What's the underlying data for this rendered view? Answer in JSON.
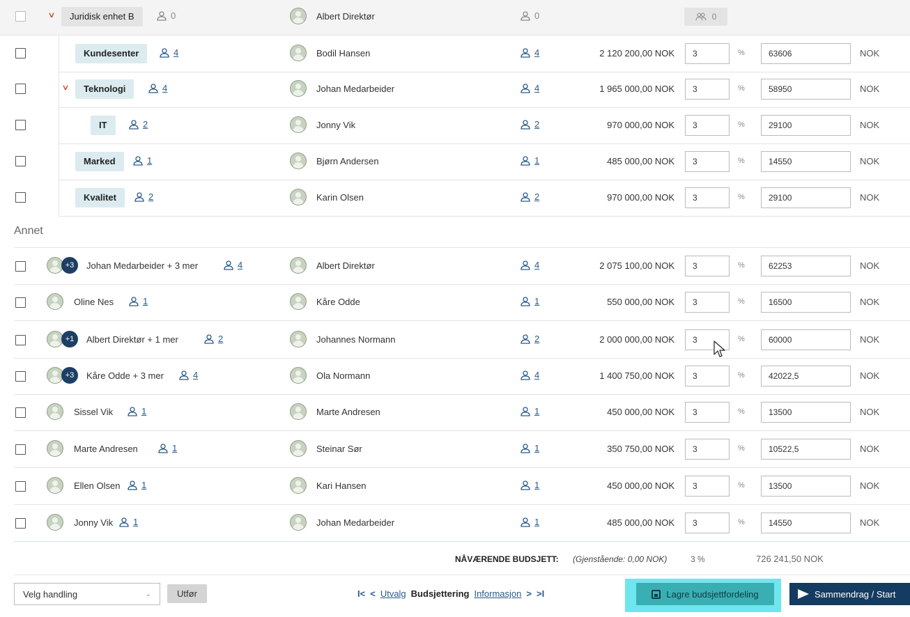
{
  "org_rows": [
    {
      "unit": "Juridisk enhet B",
      "unit_count": "0",
      "leader": "Albert Direktør",
      "leader_count": "0",
      "team_count": "0"
    },
    {
      "unit": "Kundesenter",
      "unit_count": "4",
      "leader": "Bodil Hansen",
      "leader_count": "4",
      "amount": "2 120 200,00 NOK",
      "pct": "3",
      "value": "63606",
      "currency": "NOK"
    },
    {
      "unit": "Teknologi",
      "unit_count": "4",
      "leader": "Johan Medarbeider",
      "leader_count": "4",
      "amount": "1 965 000,00 NOK",
      "pct": "3",
      "value": "58950",
      "currency": "NOK"
    },
    {
      "unit": "IT",
      "unit_count": "2",
      "leader": "Jonny Vik",
      "leader_count": "2",
      "amount": "970 000,00 NOK",
      "pct": "3",
      "value": "29100",
      "currency": "NOK"
    },
    {
      "unit": "Marked",
      "unit_count": "1",
      "leader": "Bjørn Andersen",
      "leader_count": "1",
      "amount": "485 000,00 NOK",
      "pct": "3",
      "value": "14550",
      "currency": "NOK"
    },
    {
      "unit": "Kvalitet",
      "unit_count": "2",
      "leader": "Karin Olsen",
      "leader_count": "2",
      "amount": "970 000,00 NOK",
      "pct": "3",
      "value": "29100",
      "currency": "NOK"
    }
  ],
  "section_label": "Annet",
  "other_rows": [
    {
      "badge": "+3",
      "name": "Johan Medarbeider + 3 mer",
      "count": "4",
      "leader": "Albert Direktør",
      "leader_count": "4",
      "amount": "2 075 100,00 NOK",
      "pct": "3",
      "value": "62253",
      "currency": "NOK"
    },
    {
      "badge": "",
      "name": "Oline Nes",
      "count": "1",
      "leader": "Kåre Odde",
      "leader_count": "1",
      "amount": "550 000,00 NOK",
      "pct": "3",
      "value": "16500",
      "currency": "NOK"
    },
    {
      "badge": "+1",
      "name": "Albert Direktør + 1 mer",
      "count": "2",
      "leader": "Johannes Normann",
      "leader_count": "2",
      "amount": "2 000 000,00 NOK",
      "pct": "3",
      "value": "60000",
      "currency": "NOK"
    },
    {
      "badge": "+3",
      "name": "Kåre Odde + 3 mer",
      "count": "4",
      "leader": "Ola Normann",
      "leader_count": "4",
      "amount": "1 400 750,00 NOK",
      "pct": "3",
      "value": "42022,5",
      "currency": "NOK"
    },
    {
      "badge": "",
      "name": "Sissel Vik",
      "count": "1",
      "leader": "Marte Andresen",
      "leader_count": "1",
      "amount": "450 000,00 NOK",
      "pct": "3",
      "value": "13500",
      "currency": "NOK"
    },
    {
      "badge": "",
      "name": "Marte Andresen",
      "count": "1",
      "leader": "Steinar Sør",
      "leader_count": "1",
      "amount": "350 750,00 NOK",
      "pct": "3",
      "value": "10522,5",
      "currency": "NOK"
    },
    {
      "badge": "",
      "name": "Ellen Olsen",
      "count": "1",
      "leader": "Kari Hansen",
      "leader_count": "1",
      "amount": "450 000,00 NOK",
      "pct": "3",
      "value": "13500",
      "currency": "NOK"
    },
    {
      "badge": "",
      "name": "Jonny Vik",
      "count": "1",
      "leader": "Johan Medarbeider",
      "leader_count": "1",
      "amount": "485 000,00 NOK",
      "pct": "3",
      "value": "14550",
      "currency": "NOK"
    }
  ],
  "pct_symbol": "%",
  "totals": {
    "label": "NÅVÆRENDE BUDSJETT:",
    "remaining": "(Gjenstående: 0,00 NOK)",
    "pct": "3 %",
    "sum": "726 241,50 NOK"
  },
  "footer": {
    "action_select": "Velg handling",
    "execute_label": "Utfør",
    "pager_first": "I<",
    "pager_prev": "<",
    "pager_prev_label": "Utvalg",
    "pager_current": "Budsjettering",
    "pager_next_label": "Informasjon",
    "pager_next": ">",
    "pager_last": ">I",
    "save_label": "Lagre budsjettfordeling",
    "next_label": "Sammendrag / Start"
  },
  "icons": {
    "person": "person-outline-icon",
    "team": "team-icon",
    "save": "floppy-disk-icon",
    "send": "send-arrow-icon",
    "chevron": "chevron-down-icon"
  },
  "colors": {
    "unit_tag_bg": "#dcebf0",
    "link": "#2a5a8a",
    "badge": "#1d3f63",
    "save_highlight": "#6fe6ee",
    "save_button": "#3aafb3",
    "next_button": "#143b60",
    "chevron": "#c0492b"
  }
}
